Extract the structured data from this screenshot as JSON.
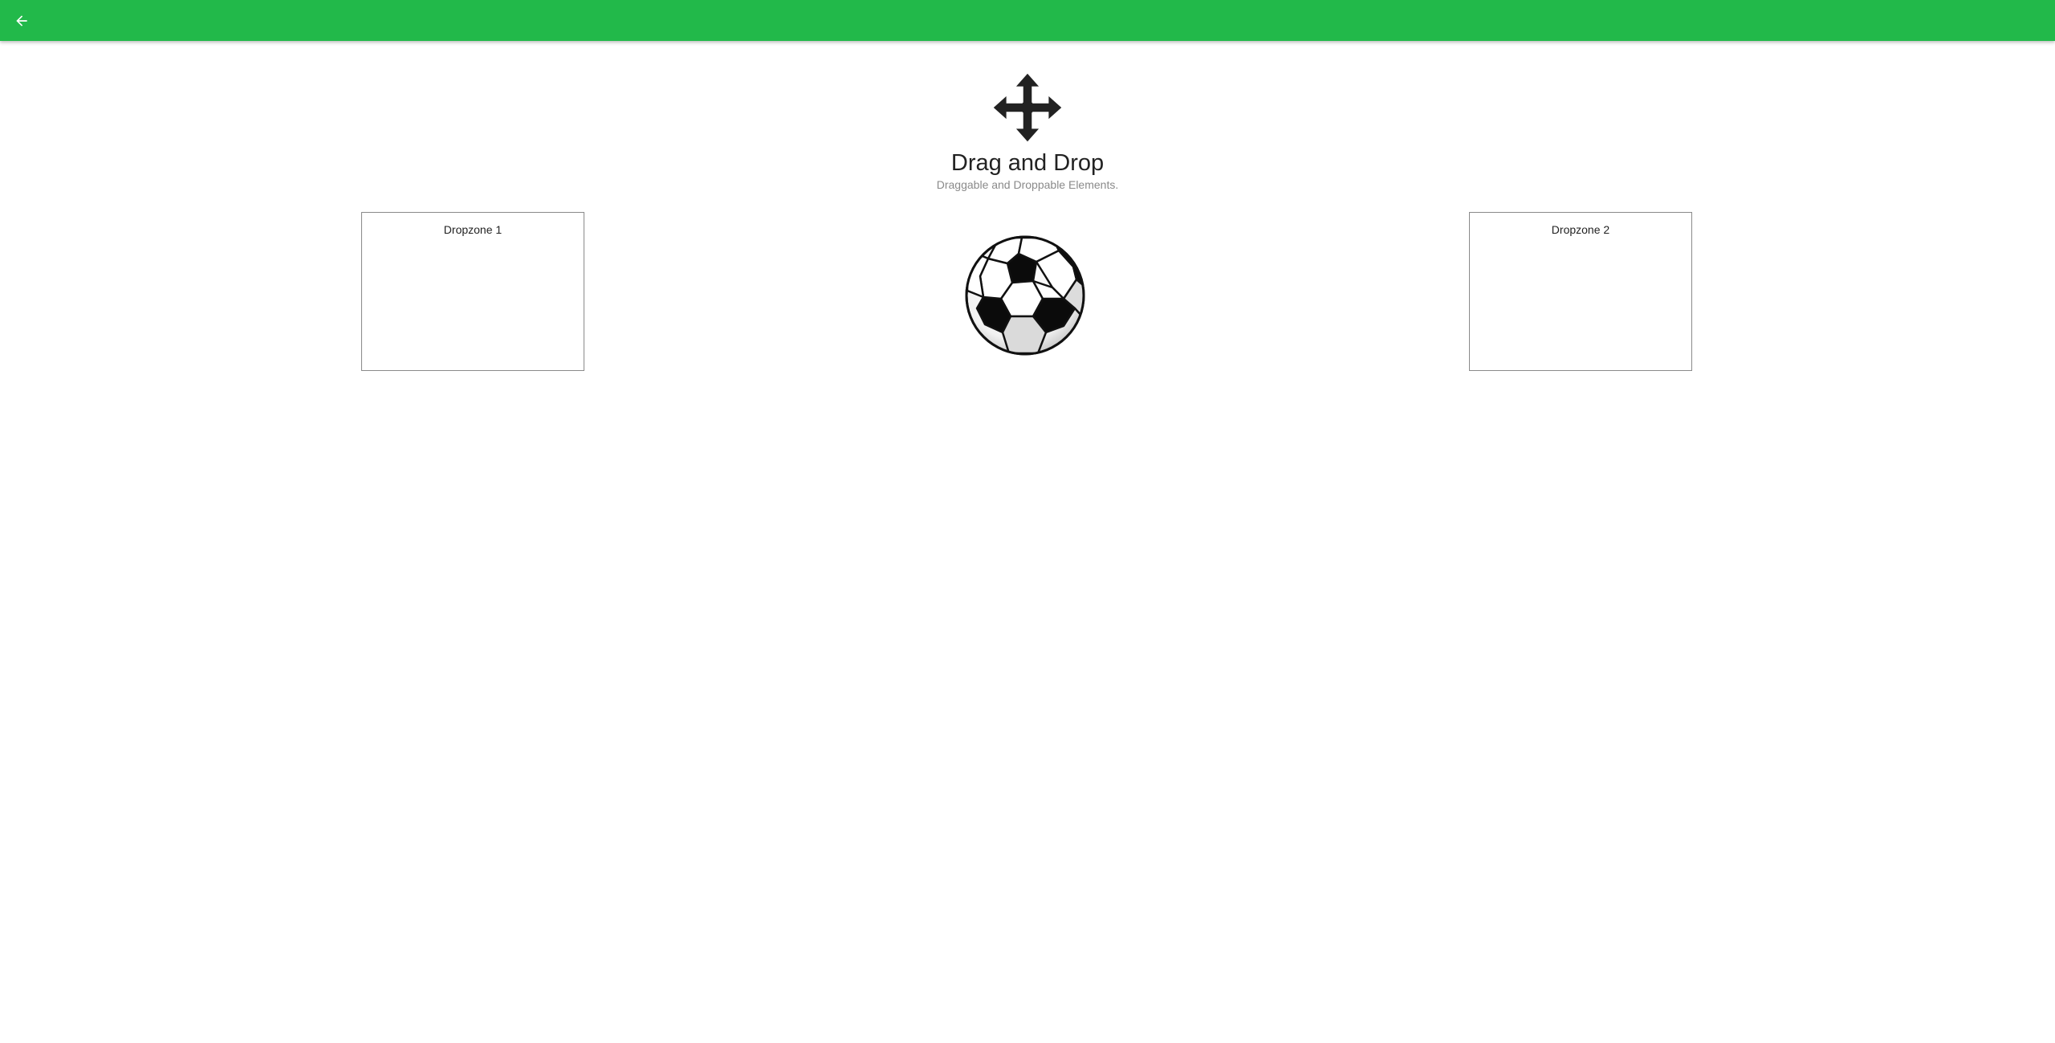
{
  "topbar": {
    "color": "#22b94a",
    "back_icon": "arrow-left-icon"
  },
  "header": {
    "icon": "move-arrows-icon",
    "title": "Drag and Drop",
    "subtitle": "Draggable and Droppable Elements."
  },
  "dropzones": [
    {
      "label": "Dropzone 1"
    },
    {
      "label": "Dropzone 2"
    }
  ],
  "draggable": {
    "icon": "soccer-ball-icon"
  }
}
